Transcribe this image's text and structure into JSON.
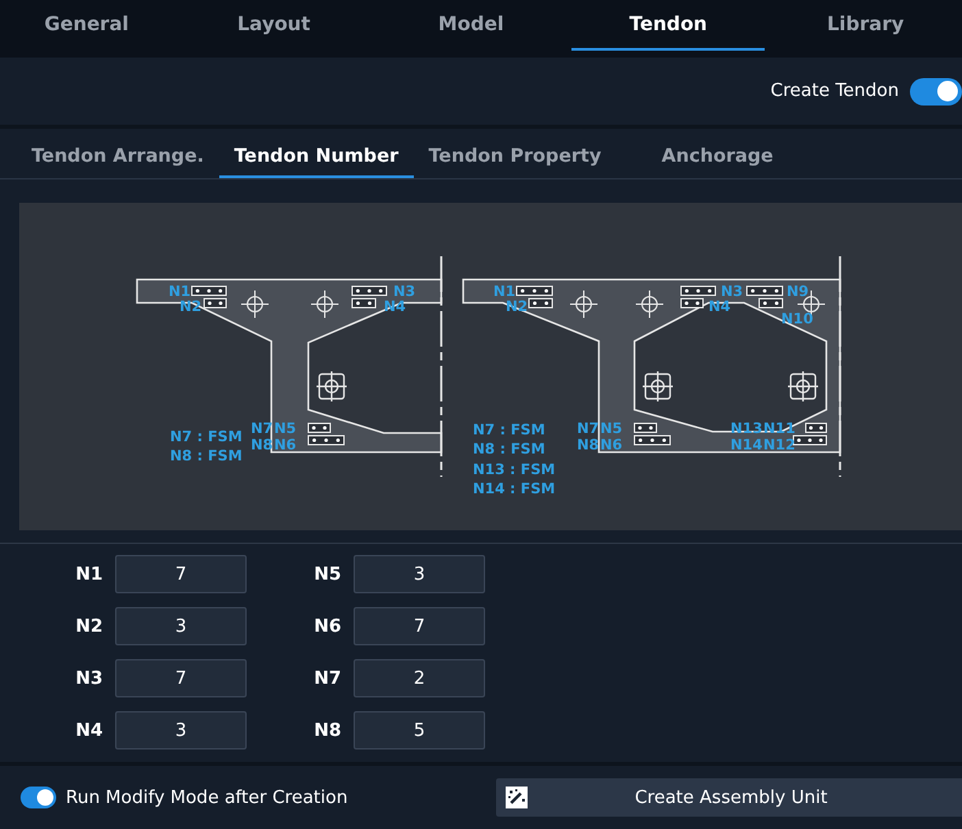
{
  "tabs": [
    {
      "label": "General",
      "selected": false
    },
    {
      "label": "Layout",
      "selected": false
    },
    {
      "label": "Model",
      "selected": false
    },
    {
      "label": "Tendon",
      "selected": true
    },
    {
      "label": "Library",
      "selected": false
    }
  ],
  "create_tendon": {
    "label": "Create Tendon",
    "on": true
  },
  "subtabs": [
    {
      "label": "Tendon Arrange.",
      "selected": false
    },
    {
      "label": "Tendon Number",
      "selected": true
    },
    {
      "label": "Tendon Property",
      "selected": false
    },
    {
      "label": "Anchorage",
      "selected": false
    }
  ],
  "diagram": {
    "sections": [
      {
        "labels": [
          "N1",
          "N2",
          "N3",
          "N4",
          "N7",
          "N5",
          "N8",
          "N6",
          "N7 : FSM",
          "N8 : FSM"
        ]
      },
      {
        "labels": [
          "N1",
          "N2",
          "N3",
          "N4",
          "N9",
          "N10",
          "N7",
          "N5",
          "N8",
          "N6",
          "N13",
          "N11",
          "N14",
          "N12",
          "N7 : FSM",
          "N8 : FSM",
          "N13 : FSM",
          "N14 : FSM"
        ]
      }
    ]
  },
  "tendon_numbers": [
    {
      "label": "N1",
      "value": "7"
    },
    {
      "label": "N2",
      "value": "3"
    },
    {
      "label": "N3",
      "value": "7"
    },
    {
      "label": "N4",
      "value": "3"
    },
    {
      "label": "N5",
      "value": "3"
    },
    {
      "label": "N6",
      "value": "7"
    },
    {
      "label": "N7",
      "value": "2"
    },
    {
      "label": "N8",
      "value": "5"
    }
  ],
  "run_modify": {
    "label": "Run Modify Mode after Creation",
    "on": true
  },
  "create_button": {
    "label": "Create Assembly Unit"
  }
}
